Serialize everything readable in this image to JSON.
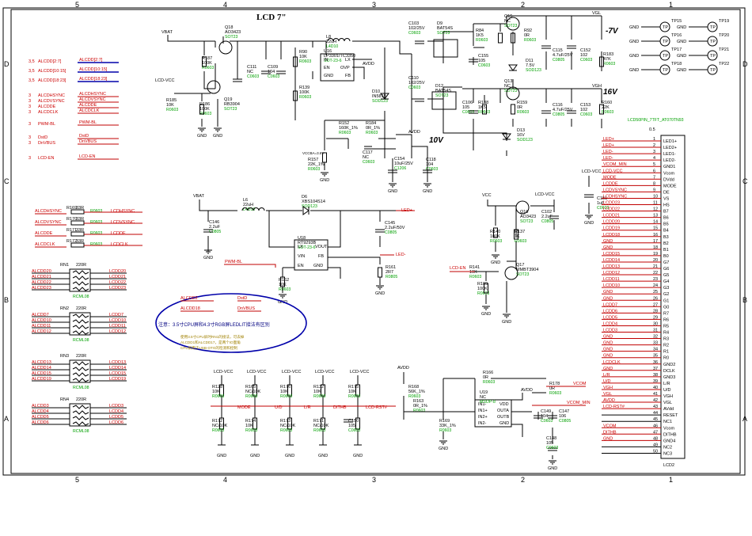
{
  "sheet": {
    "title": "LCD 7\"",
    "zones_top": [
      "5",
      "4",
      "3",
      "2",
      "1"
    ],
    "zones_side": [
      "D",
      "C",
      "B",
      "A"
    ],
    "rails": {
      "neg7": "-7V",
      "pos16": "16V",
      "pos10": "10V",
      "vgl": "VGL",
      "vgh": "VGH",
      "avdd": "AVDD",
      "vbat": "VBAT",
      "vcc": "VCC",
      "lcdvcc": "LCD-VCC",
      "gnd": "GND",
      "ledp": "LED+",
      "ledm": "LED-"
    },
    "nets_left": [
      "ALCDD[2:7]",
      "ALCDD[10:15]",
      "ALCDD[18:23]",
      "ALCDHSYNC",
      "ALCDVSYNC",
      "ALCDDE",
      "ALCDCLK",
      "PWM-BL",
      "DstD",
      "DnVBUS",
      "LCD-EN"
    ],
    "nets_left_num": [
      "3,5",
      "3,5",
      "3,5",
      "3",
      "3",
      "3",
      "3",
      "3",
      "3",
      "3",
      "3"
    ],
    "nets_left_local": [
      "ALCDD[2:7]",
      "ALCDD[10:15]",
      "ALCDD[18:23]",
      "ALCDHSYNC",
      "ALCDVSYNC",
      "ALCDDE",
      "ALCDCLK",
      "PWM-BL",
      "DstD",
      "DnVBUS",
      "LCD-EN"
    ]
  },
  "parts": {
    "q18": [
      "Q18",
      "AO3423",
      "SOT23"
    ],
    "r187": [
      "R187",
      "100K",
      "R0603"
    ],
    "r185": [
      "R185",
      "10K",
      "R0603"
    ],
    "r186": [
      "R186",
      "100K",
      "R0603"
    ],
    "q19": [
      "Q19",
      "RB3904",
      "SOT23"
    ],
    "l8": [
      "L8",
      "22uH",
      "L4D10"
    ],
    "c111": [
      "C111",
      "NC",
      "C0603"
    ],
    "c109": [
      "C109",
      "104",
      "C0603"
    ],
    "r90": [
      "R90",
      "10K",
      "R0603"
    ],
    "r139": [
      "R139",
      "100K",
      "R0603"
    ],
    "u16": [
      "U16",
      "LP3301/TC3350",
      "SOT-23-6"
    ],
    "d10": [
      "D10",
      "IN5819",
      "SOD123"
    ],
    "c103": [
      "C103",
      "102/25V",
      "C0603"
    ],
    "c110": [
      "C110",
      "102/25V",
      "C0603"
    ],
    "d9": [
      "D9",
      "BAT54S",
      "SOT23"
    ],
    "d12": [
      "D12",
      "BAT54S",
      "SOT23"
    ],
    "q15": [
      "Q15",
      "NC",
      "SOT23"
    ],
    "r84": [
      "R84",
      "1K5",
      "R0603"
    ],
    "r92": [
      "R92",
      "0R",
      "R0603"
    ],
    "d11": [
      "D11",
      "7.5V",
      "SOD123"
    ],
    "c155": [
      "C155",
      "105",
      "C0603"
    ],
    "c115": [
      "C115",
      "4.7uF/25V",
      "C0805"
    ],
    "c152": [
      "C152",
      "102",
      "C0603"
    ],
    "r183": [
      "R183",
      "47K",
      "R0603"
    ],
    "q13": [
      "Q13",
      "NC",
      "SOT23"
    ],
    "r138": [
      "R138",
      "1K5",
      "R0603"
    ],
    "r159": [
      "R159",
      "0R",
      "R0603"
    ],
    "c106": [
      "C106",
      "105",
      "C0603"
    ],
    "d13": [
      "D13",
      "16V",
      "SOD123"
    ],
    "c116": [
      "C116",
      "4.7uF/25V",
      "C0805"
    ],
    "c153": [
      "C153",
      "102",
      "C0603"
    ],
    "r160": [
      "R160",
      "22K",
      "R0603"
    ],
    "r152": [
      "R152",
      "160K_1%",
      "R0603"
    ],
    "r184": [
      "R184",
      "0R_1%",
      "R0603"
    ],
    "c117": [
      "C117",
      "NC",
      "C0603"
    ],
    "c154": [
      "C154",
      "10uF/25V",
      "C1206"
    ],
    "c118": [
      "C118",
      "104",
      "C0603"
    ],
    "r157": [
      "R157",
      "22K_1%",
      "R0603"
    ],
    "l6": [
      "L6",
      "22uH",
      "L4D10"
    ],
    "d6": [
      "D6",
      "XBS104S14",
      "SOD123"
    ],
    "c146": [
      "C146",
      "2.2uF",
      "C0805"
    ],
    "c145": [
      "C145",
      "2.2uF/50V",
      "C0805"
    ],
    "u18": [
      "U18",
      "RT9293B",
      "SOT-23-6"
    ],
    "r162": [
      "R162",
      "10K",
      "R0603"
    ],
    "r161": [
      "R161",
      "2R7",
      "R0805"
    ],
    "q16": [
      "Q16",
      "AO3423",
      "SOT23"
    ],
    "c102": [
      "C102",
      "2.2uF",
      "C0805"
    ],
    "r140": [
      "R140",
      "100K",
      "R0603"
    ],
    "r137": [
      "R137",
      "1K",
      "R0603"
    ],
    "r141": [
      "R141",
      "10K",
      "R0603"
    ],
    "r109": [
      "R109",
      "100K",
      "R0603"
    ],
    "q17": [
      "Q17",
      "MMBT3904",
      "SOT23"
    ],
    "c151": [
      "C151",
      "1uF",
      "C0603"
    ],
    "rn1": [
      "RN1",
      "220R",
      "RCML08"
    ],
    "rn2": [
      "RN2",
      "220R",
      "RCML08"
    ],
    "rn3": [
      "RN3",
      "220R",
      "RCML08"
    ],
    "rn4": [
      "RN4",
      "220R",
      "RCML08"
    ],
    "r169": [
      "R169",
      "0R",
      "R0603"
    ],
    "r170": [
      "R170",
      "0R",
      "R0603"
    ],
    "r171": [
      "R171",
      "0R",
      "R0603"
    ],
    "r172": [
      "R172",
      "0R",
      "R0603"
    ],
    "r128": [
      "R128",
      "10K",
      "R0603"
    ],
    "r172b": [
      "R172",
      "NC/10K",
      "R0603"
    ],
    "r165": [
      "R165",
      "NC/10K",
      "R0603"
    ],
    "r174": [
      "R174",
      "10K",
      "R0603"
    ],
    "r176": [
      "R176",
      "10K",
      "R0603"
    ],
    "r173": [
      "R173",
      "NC/10K",
      "R0603"
    ],
    "r132": [
      "R132",
      "10K",
      "R0603"
    ],
    "r171b": [
      "R171",
      "NC/10K",
      "R0603"
    ],
    "r175": [
      "R175",
      "10K",
      "R0603"
    ],
    "c150": [
      "C150",
      "105",
      "C0603"
    ],
    "r168": [
      "R168",
      "56K_1%",
      "R0603"
    ],
    "r163": [
      "R163",
      "0R_1%",
      "R0603"
    ],
    "r166": [
      "R166",
      "0R",
      "R0603"
    ],
    "r169b": [
      "R169",
      "33K_1%",
      "R0603"
    ],
    "u19": [
      "U19",
      "NC",
      "MSOP-8"
    ],
    "r178": [
      "R178",
      "0R",
      "R0603"
    ],
    "c149": [
      "C149",
      "104",
      "C0603"
    ],
    "c147": [
      "C147",
      "106",
      "C0805"
    ],
    "c148": [
      "C148",
      "105",
      "C0603"
    ]
  },
  "rn_blocks": [
    {
      "left": [
        "ALCDD20",
        "ALCDD21",
        "ALCDD22",
        "ALCDD23"
      ],
      "right": [
        "LCDD20",
        "LCDD21",
        "LCDD22",
        "LCDD23"
      ]
    },
    {
      "left": [
        "ALCDD7",
        "ALCDD10",
        "ALCDD11",
        "ALCDD12"
      ],
      "right": [
        "LCDD7",
        "LCDD10",
        "LCDD11",
        "LCDD12"
      ]
    },
    {
      "left": [
        "ALCDD13",
        "ALCDD14",
        "ALCDD15",
        "ALCDD19"
      ],
      "right": [
        "LCDD13",
        "LCDD14",
        "LCDD15",
        "LCDD19"
      ]
    },
    {
      "left": [
        "ALCDD3",
        "ALCDD4",
        "ALCDD5",
        "ALCDD6"
      ],
      "right": [
        "LCDD3",
        "LCDD4",
        "LCDD5",
        "LCDD6"
      ]
    }
  ],
  "sync": [
    {
      "left": "ALCDHSYNC",
      "ref": "R169",
      "val": "33R",
      "pkg": "R0603",
      "right": "LCDHSYNC"
    },
    {
      "left": "ALCDVSYNC",
      "ref": "R170",
      "val": "33R",
      "pkg": "R0603",
      "right": "LCDVSYNC"
    },
    {
      "left": "ALCDDE",
      "ref": "R171",
      "val": "33R",
      "pkg": "R0603",
      "right": "LCDDE"
    },
    {
      "left": "ALCDCLK",
      "ref": "R172",
      "val": "33R",
      "pkg": "R0603",
      "right": "LCDCLK"
    }
  ],
  "tp": [
    {
      "ref": "TP15",
      "n": "TP"
    },
    {
      "ref": "TP16",
      "n": "TP"
    },
    {
      "ref": "TP17",
      "n": "TP"
    },
    {
      "ref": "TP18",
      "n": "TP"
    },
    {
      "ref": "TP19",
      "n": "TP"
    },
    {
      "ref": "TP20",
      "n": "TP"
    },
    {
      "ref": "TP21",
      "n": "TP"
    },
    {
      "ref": "TP22",
      "n": "TP"
    }
  ],
  "connector": {
    "title": "LCD50PIN_7TFT_AT070TN93",
    "ref": "LCD2",
    "pins": [
      [
        "LED+",
        "1",
        "LED1+"
      ],
      [
        "LED+",
        "2",
        "LED2+"
      ],
      [
        "LED-",
        "3",
        "LED1-"
      ],
      [
        "LED-",
        "4",
        "LED2-"
      ],
      [
        "VCOM_MIN",
        "5",
        "GND1"
      ],
      [
        "LCD-VCC",
        "6",
        "Vcom"
      ],
      [
        "MODE",
        "7",
        "DVdd"
      ],
      [
        "LCDDE",
        "8",
        "MODE"
      ],
      [
        "LCDVSYNC",
        "9",
        "DE"
      ],
      [
        "LCDHSYNC",
        "10",
        "VS"
      ],
      [
        "LCDD23",
        "11",
        "HS"
      ],
      [
        "LCDD22",
        "12",
        "B7"
      ],
      [
        "LCDD21",
        "13",
        "B6"
      ],
      [
        "LCDD20",
        "14",
        "B5"
      ],
      [
        "LCDD19",
        "15",
        "B4"
      ],
      [
        "LCDD18",
        "16",
        "B3"
      ],
      [
        "GND",
        "17",
        "B2"
      ],
      [
        "GND",
        "18",
        "B1"
      ],
      [
        "LCDD15",
        "19",
        "B0"
      ],
      [
        "LCDD14",
        "20",
        "G7"
      ],
      [
        "LCDD13",
        "21",
        "G6"
      ],
      [
        "LCDD12",
        "22",
        "G5"
      ],
      [
        "LCDD11",
        "23",
        "G4"
      ],
      [
        "LCDD10",
        "24",
        "G3"
      ],
      [
        "GND",
        "25",
        "G2"
      ],
      [
        "GND",
        "26",
        "G1"
      ],
      [
        "LCDD7",
        "27",
        "G0"
      ],
      [
        "LCDD6",
        "28",
        "R7"
      ],
      [
        "LCDD5",
        "29",
        "R6"
      ],
      [
        "LCDD4",
        "30",
        "R5"
      ],
      [
        "LCDD3",
        "31",
        "R4"
      ],
      [
        "GND",
        "32",
        "R3"
      ],
      [
        "GND",
        "33",
        "R2"
      ],
      [
        "GND",
        "34",
        "R1"
      ],
      [
        "GND",
        "35",
        "R0"
      ],
      [
        "LCDCLK",
        "36",
        "GND2"
      ],
      [
        "GND",
        "37",
        "DCLK"
      ],
      [
        "L/R",
        "38",
        "GND3"
      ],
      [
        "U/D",
        "39",
        "L/R"
      ],
      [
        "VGH",
        "40",
        "U/D"
      ],
      [
        "VGL",
        "41",
        "VGH"
      ],
      [
        "AVDD",
        "42",
        "VGL"
      ],
      [
        "LCD-RST#",
        "43",
        "AVdd"
      ],
      [
        "",
        "44",
        "RESET"
      ],
      [
        "",
        "45",
        "NC1"
      ],
      [
        "VCOM",
        "46",
        "Vcom"
      ],
      [
        "DITHB",
        "47",
        "DITHB"
      ],
      [
        "GND",
        "48",
        "GND4"
      ],
      [
        "",
        "49",
        "NC2"
      ],
      [
        "",
        "50",
        "NC3"
      ]
    ]
  },
  "note": {
    "line1": "注意：3.5寸CPU屏和4.3寸RGB屏LEDLIT接法有区别",
    "line2": "使用3.5寸CPU屏时RN1的接法，可去掉",
    "line3": "ALCDD1和ALCDD17，是两个IO面角",
    "line4": "CPU屏用于USB-OTG的检测和控制",
    "pair1": [
      "ALCDD2",
      "DstD"
    ],
    "pair2": [
      "ALCDD18",
      "DnVBUS"
    ]
  },
  "labels": {
    "mode": "MODE",
    "ud": "U/D",
    "lr": "L/R",
    "dithb": "DITHB",
    "lcdrst": "LCD-RST#",
    "vcom": "VCOM",
    "vcommin": "VCOM_MIN",
    "lcdvcc": "LCD-VCC",
    "pwmbl": "PWM-BL",
    "lcden": "LCD-EN",
    "vcc_net": "VCCBA=3.6V",
    "ss": "0.5"
  }
}
